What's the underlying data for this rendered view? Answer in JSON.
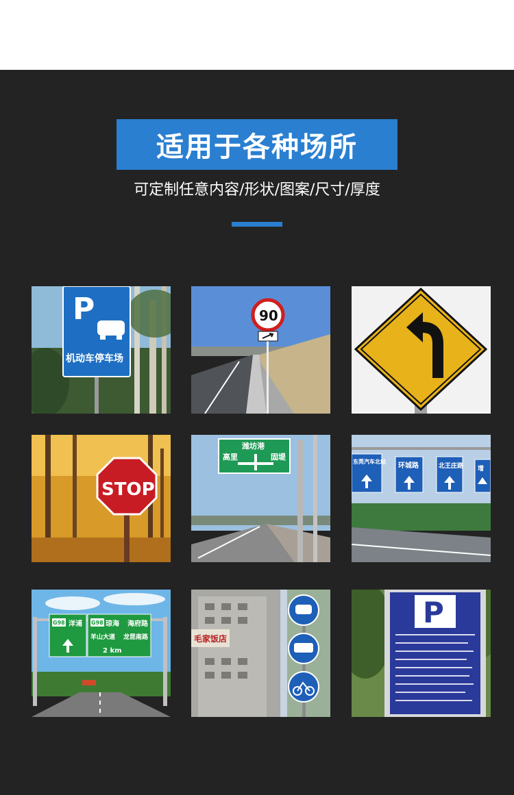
{
  "header": {
    "title": "适用于各种场所",
    "subtitle": "可定制任意内容/形状/图案/尺寸/厚度"
  },
  "colors": {
    "background": "#232323",
    "accent": "#2a7fd0"
  },
  "gallery": {
    "parking": {
      "letter": "P",
      "label": "机动车停车场"
    },
    "speed": {
      "value": "90"
    },
    "stop": {
      "label": "STOP"
    },
    "guide": {
      "top": "潍坊港",
      "left": "高里",
      "right": "固堤"
    },
    "overhead": {
      "sign1": "东莞汽车北站",
      "sign2": "环城路",
      "sign3": "北王庄路",
      "sign4": "增"
    },
    "highway": {
      "route1": "G98",
      "place1": "洋浦",
      "route2": "G98",
      "place2": "琼海",
      "place3": "海府路",
      "place4": "羊山大道",
      "place5": "龙昆南路",
      "distance": "2 km"
    },
    "street": {
      "building": "毛家饭店"
    },
    "info_board": {
      "letter": "P"
    }
  }
}
